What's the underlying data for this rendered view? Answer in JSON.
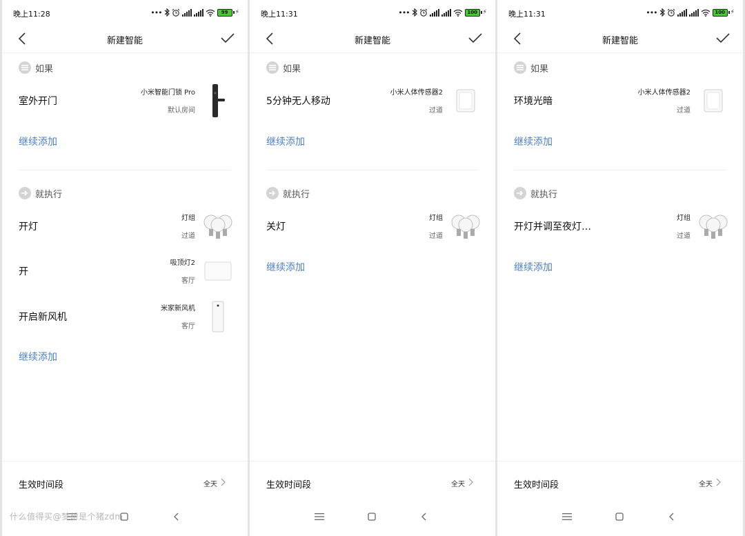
{
  "screens": [
    {
      "status_time": "晚上11:28",
      "battery": "99",
      "title": "新建智能",
      "if_label": "如果",
      "then_label": "就执行",
      "conditions": [
        {
          "name": "室外开门",
          "device": "小米智能门锁 Pro",
          "room": "默认房间",
          "icon": "door-lock-icon"
        }
      ],
      "condition_add": "继续添加",
      "actions": [
        {
          "name": "开灯",
          "device": "灯组",
          "room": "过道",
          "icon": "light-bulbs-icon"
        },
        {
          "name": "开",
          "device": "吸顶灯2",
          "room": "客厅",
          "icon": "ceiling-light-icon"
        },
        {
          "name": "开启新风机",
          "device": "米家新风机",
          "room": "客厅",
          "icon": "air-purifier-icon"
        }
      ],
      "action_add": "继续添加",
      "effective_label": "生效时间段",
      "effective_value": "全天"
    },
    {
      "status_time": "晚上11:31",
      "battery": "100",
      "title": "新建智能",
      "if_label": "如果",
      "then_label": "就执行",
      "conditions": [
        {
          "name": "5分钟无人移动",
          "device": "小米人体传感器2",
          "room": "过道",
          "icon": "motion-sensor-icon"
        }
      ],
      "condition_add": "继续添加",
      "actions": [
        {
          "name": "关灯",
          "device": "灯组",
          "room": "过道",
          "icon": "light-bulbs-icon"
        }
      ],
      "action_add": "继续添加",
      "effective_label": "生效时间段",
      "effective_value": "全天"
    },
    {
      "status_time": "晚上11:31",
      "battery": "100",
      "title": "新建智能",
      "if_label": "如果",
      "then_label": "就执行",
      "conditions": [
        {
          "name": "环境光暗",
          "device": "小米人体传感器2",
          "room": "过道",
          "icon": "motion-sensor-icon"
        }
      ],
      "condition_add": "继续添加",
      "actions": [
        {
          "name": "开灯并调至夜灯…",
          "device": "灯组",
          "room": "过道",
          "icon": "light-bulbs-icon"
        }
      ],
      "action_add": "继续添加",
      "effective_label": "生效时间段",
      "effective_value": "全天"
    }
  ],
  "watermark": "什么值得买@梦想是个猪zdm",
  "colors": {
    "accent": "#4e80c4",
    "battery": "#4fc53c",
    "background": "#ffffff"
  }
}
